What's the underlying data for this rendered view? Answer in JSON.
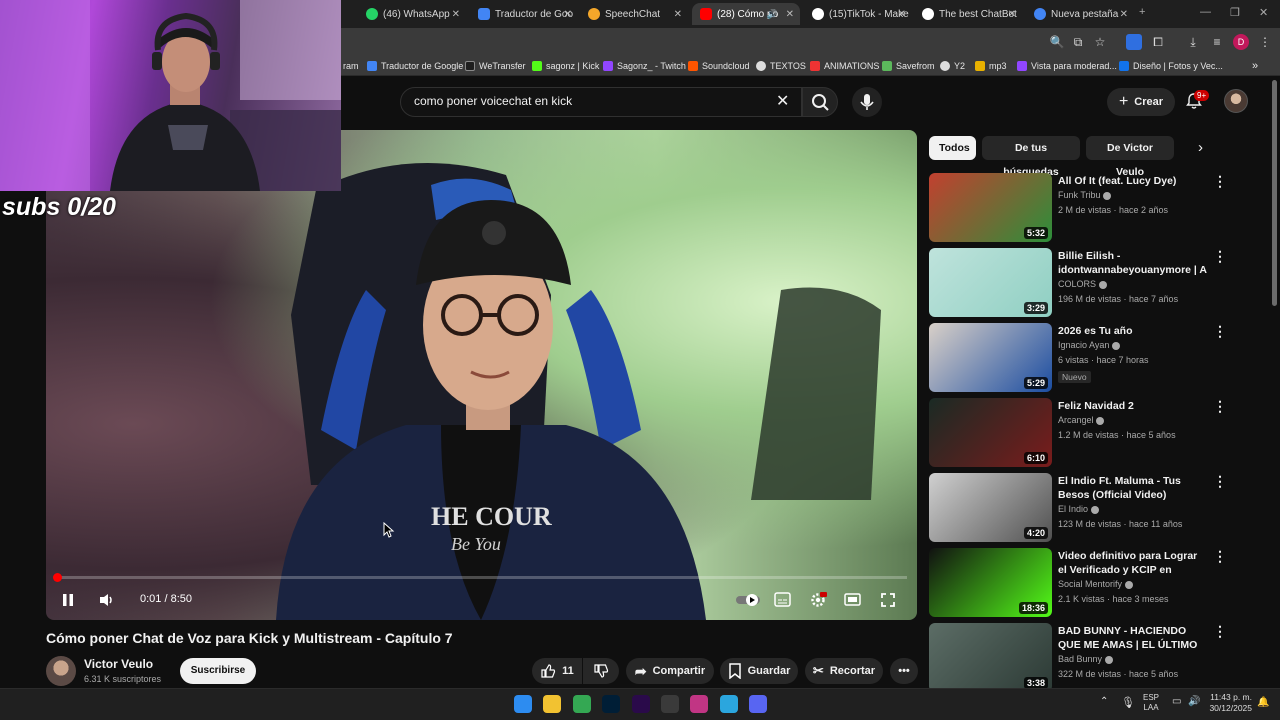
{
  "browser": {
    "tabs": [
      {
        "label": "(46) WhatsApp",
        "icon": "whatsapp-icon",
        "color": "#25d366"
      },
      {
        "label": "Traductor de Goo",
        "icon": "google-translate-icon",
        "color": "#4285f4"
      },
      {
        "label": "SpeechChat",
        "icon": "speechchat-icon",
        "color": "#f4a72a"
      },
      {
        "label": "(28) Cómo po",
        "icon": "youtube-icon",
        "color": "#ff0000",
        "active": true
      },
      {
        "label": "(15)TikTok - Make",
        "icon": "tiktok-icon",
        "color": "#ffffff"
      },
      {
        "label": "The best ChatBot",
        "icon": "chatbot-icon",
        "color": "#ffffff"
      },
      {
        "label": "Nueva pestaña",
        "icon": "chrome-icon",
        "color": "#4285f4"
      }
    ],
    "new_tab": "+",
    "bookmarks": [
      {
        "label": "ram",
        "icon": "instagram-icon",
        "color": "#c13584"
      },
      {
        "label": "Traductor de Google",
        "icon": "google-translate-icon",
        "color": "#4285f4"
      },
      {
        "label": "WeTransfer",
        "icon": "wetransfer-icon",
        "color": "#1e1e1e"
      },
      {
        "label": "sagonz | Kick",
        "icon": "kick-icon",
        "color": "#53fc18"
      },
      {
        "label": "Sagonz_ - Twitch",
        "icon": "twitch-icon",
        "color": "#9146ff"
      },
      {
        "label": "Soundcloud",
        "icon": "soundcloud-icon",
        "color": "#ff5500"
      },
      {
        "label": "TEXTOS",
        "icon": "globe-icon",
        "color": "#dddddd"
      },
      {
        "label": "ANIMATIONS",
        "icon": "folder-icon",
        "color": "#e33"
      },
      {
        "label": "Savefrom",
        "icon": "savefrom-icon",
        "color": "#5cb85c"
      },
      {
        "label": "Y2",
        "icon": "y2-icon",
        "color": "#dddddd"
      },
      {
        "label": "mp3",
        "icon": "mp3-icon",
        "color": "#e8b100"
      },
      {
        "label": "Vista para moderad...",
        "icon": "twitch-icon",
        "color": "#9146ff"
      },
      {
        "label": "Diseño | Fotos y Vec...",
        "icon": "freepik-icon",
        "color": "#1273eb"
      }
    ],
    "profile_initial": "D"
  },
  "youtube": {
    "search_query": "como poner voicechat en kick",
    "create_label": "Crear",
    "notification_count": "9+"
  },
  "overlay": {
    "subs_text": "subs 0/20"
  },
  "player": {
    "time": "0:01 / 8:50",
    "progress": 0.002
  },
  "video": {
    "title": "Cómo poner Chat de Voz para Kick y Multistream - Capítulo 7",
    "channel": "Victor Veulo",
    "subscribers": "6.31 K suscriptores",
    "subscribe_label": "Suscribirse",
    "likes": "11",
    "share_label": "Compartir",
    "save_label": "Guardar",
    "clip_label": "Recortar"
  },
  "chips": [
    "Todos",
    "De tus búsquedas",
    "De Victor Veulo"
  ],
  "recommendations": [
    {
      "title": "All Of It (feat. Lucy Dye)",
      "channel": "Funk Tribu",
      "meta": "2 M de vistas · hace 2 años",
      "duration": "5:32",
      "thumb": [
        "#c2402f",
        "#2c8f3a"
      ]
    },
    {
      "title": "Billie Eilish - idontwannabeyouanymore | A ...",
      "channel": "COLORS",
      "meta": "196 M de vistas · hace 7 años",
      "duration": "3:29",
      "thumb": [
        "#bfe3dc",
        "#8fcfc2"
      ]
    },
    {
      "title": "2026 es Tu año",
      "channel": "Ignacio Ayan",
      "meta": "6 vistas · hace 7 horas",
      "duration": "5:29",
      "badge": "Nuevo",
      "thumb": [
        "#d9d0c8",
        "#1b4da1"
      ]
    },
    {
      "title": "Feliz Navidad 2",
      "channel": "Arcangel",
      "meta": "1.2 M de vistas · hace 5 años",
      "duration": "6:10",
      "thumb": [
        "#1a2a24",
        "#7a1c1c"
      ]
    },
    {
      "title": "El Indio Ft. Maluma - Tus Besos (Official Video)",
      "channel": "El Indio",
      "meta": "123 M de vistas · hace 11 años",
      "duration": "4:20",
      "thumb": [
        "#d0d0d0",
        "#505050"
      ]
    },
    {
      "title": "Video definitivo para Lograr el Verificado y KCIP en KICK.co...",
      "channel": "Social Mentorify",
      "meta": "2.1 K vistas · hace 3 meses",
      "duration": "18:36",
      "thumb": [
        "#111111",
        "#53fc18"
      ]
    },
    {
      "title": "BAD BUNNY - HACIENDO QUE ME AMAS | EL ÚLTIMO TOUR ...",
      "channel": "Bad Bunny",
      "meta": "322 M de vistas · hace 5 años",
      "duration": "3:38",
      "thumb": [
        "#5c6d66",
        "#2c3a35"
      ]
    }
  ],
  "taskbar": {
    "apps": [
      {
        "icon": "windows-start-icon",
        "color": "#2d8cf0"
      },
      {
        "icon": "file-explorer-icon",
        "color": "#f2c231"
      },
      {
        "icon": "chrome-icon",
        "color": "#34a853"
      },
      {
        "icon": "photoshop-icon",
        "color": "#001e36"
      },
      {
        "icon": "premiere-icon",
        "color": "#2a0a4a"
      },
      {
        "icon": "obs-icon",
        "color": "#3a3a3a"
      },
      {
        "icon": "instagram-icon",
        "color": "#c13584"
      },
      {
        "icon": "notes-icon",
        "color": "#2ba6de"
      },
      {
        "icon": "discord-icon",
        "color": "#5865f2"
      }
    ],
    "language": "ESP",
    "region": "LAA",
    "time": "11:43 p. m.",
    "date": "30/12/2025"
  }
}
